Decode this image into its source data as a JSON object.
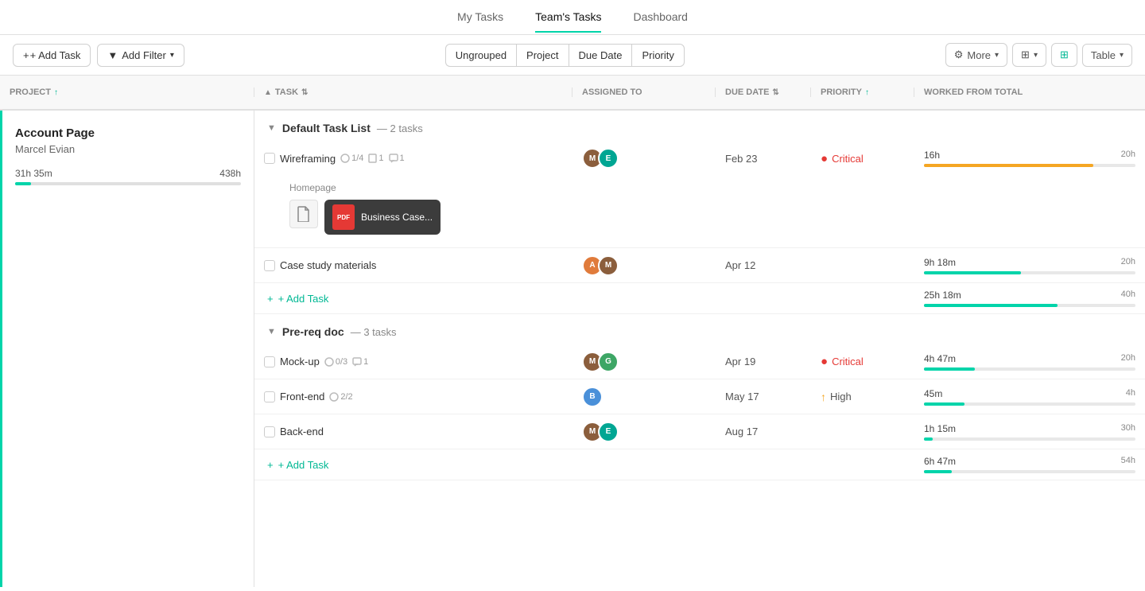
{
  "nav": {
    "items": [
      {
        "label": "My Tasks",
        "active": false
      },
      {
        "label": "Team's Tasks",
        "active": true
      },
      {
        "label": "Dashboard",
        "active": false
      }
    ]
  },
  "toolbar": {
    "add_task": "+ Add Task",
    "add_filter": "Add Filter",
    "ungrouped": "Ungrouped",
    "project": "Project",
    "due_date": "Due Date",
    "priority": "Priority",
    "more": "More",
    "table": "Table"
  },
  "columns": {
    "project": "PROJECT",
    "task": "TASK",
    "assigned_to": "ASSIGNED TO",
    "due_date": "DUE DATE",
    "priority": "PRIORITY",
    "worked_from_total": "WORKED FROM TOTAL"
  },
  "sidebar": {
    "project_name": "Account Page",
    "person": "Marcel Evian",
    "worked": "31h 35m",
    "total": "438h",
    "progress_pct": 7
  },
  "sections": [
    {
      "name": "Default Task List",
      "count": "2 tasks",
      "tasks": [
        {
          "name": "Wireframing",
          "subtasks": "1/4",
          "docs": "1",
          "comments": "1",
          "avatars": [
            "brown",
            "teal"
          ],
          "due_date": "Feb 23",
          "priority": "Critical",
          "priority_type": "critical",
          "worked": "16h",
          "total": "20h",
          "bar_pct": 80,
          "bar_color": "orange",
          "has_attachment": true,
          "attachment_label": "Homepage",
          "attachment_tooltip": "Business Case..."
        },
        {
          "name": "Case study materials",
          "subtasks": "",
          "docs": "",
          "comments": "",
          "avatars": [
            "orange",
            "brown"
          ],
          "due_date": "Apr 12",
          "priority": "",
          "priority_type": "",
          "worked": "9h 18m",
          "total": "20h",
          "bar_pct": 46,
          "bar_color": "teal",
          "has_attachment": false
        }
      ],
      "add_task_label": "+ Add Task",
      "section_total_worked": "25h 18m",
      "section_total": "40h",
      "section_bar_pct": 63,
      "section_bar_color": "teal"
    },
    {
      "name": "Pre-req doc",
      "count": "3 tasks",
      "tasks": [
        {
          "name": "Mock-up",
          "subtasks": "0/3",
          "docs": "",
          "comments": "1",
          "avatars": [
            "brown",
            "green"
          ],
          "due_date": "Apr 19",
          "priority": "Critical",
          "priority_type": "critical",
          "worked": "4h 47m",
          "total": "20h",
          "bar_pct": 24,
          "bar_color": "teal",
          "has_attachment": false
        },
        {
          "name": "Front-end",
          "subtasks": "2/2",
          "docs": "",
          "comments": "",
          "avatars": [
            "blue"
          ],
          "due_date": "May 17",
          "priority": "High",
          "priority_type": "high",
          "worked": "45m",
          "total": "4h",
          "bar_pct": 19,
          "bar_color": "teal",
          "has_attachment": false
        },
        {
          "name": "Back-end",
          "subtasks": "",
          "docs": "",
          "comments": "",
          "avatars": [
            "brown",
            "teal"
          ],
          "due_date": "Aug 17",
          "priority": "",
          "priority_type": "",
          "worked": "1h 15m",
          "total": "30h",
          "bar_pct": 4,
          "bar_color": "teal",
          "has_attachment": false
        }
      ],
      "add_task_label": "+ Add Task",
      "section_total_worked": "6h 47m",
      "section_total": "54h",
      "section_bar_pct": 13,
      "section_bar_color": "teal"
    }
  ]
}
